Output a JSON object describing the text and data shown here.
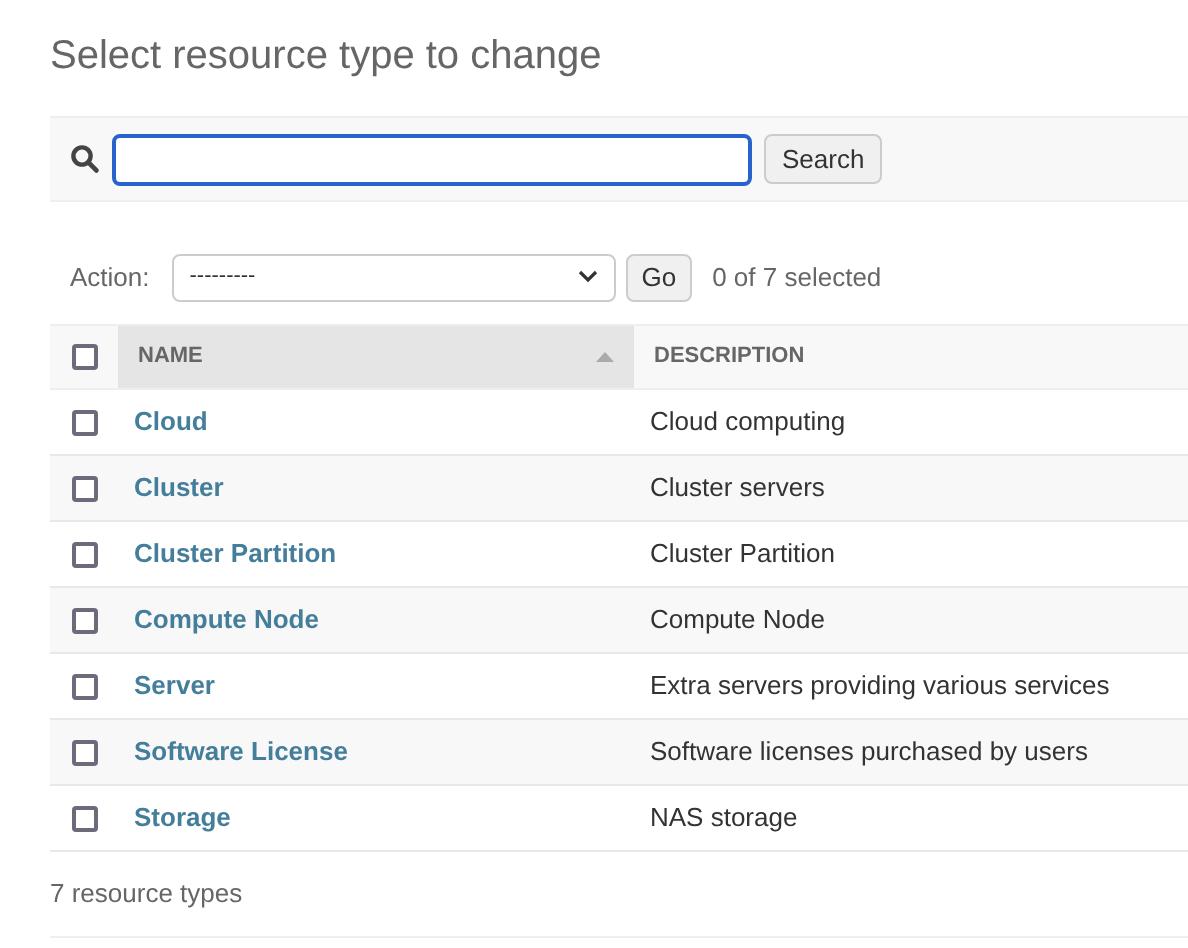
{
  "title": "Select resource type to change",
  "search": {
    "focused": true,
    "button": "Search"
  },
  "actions": {
    "label": "Action:",
    "value": "---------",
    "button": "Go",
    "counter": "0 of 7 selected"
  },
  "table": {
    "select_all": {
      "checked": false
    },
    "columns": [
      {
        "label": "NAME",
        "sorted": true
      },
      {
        "label": "DESCRIPTION",
        "sorted": false
      }
    ],
    "rows": [
      {
        "checked": false,
        "name": "Cloud",
        "description": "Cloud computing"
      },
      {
        "checked": false,
        "name": "Cluster",
        "description": "Cluster servers"
      },
      {
        "checked": false,
        "name": "Cluster Partition",
        "description": "Cluster Partition"
      },
      {
        "checked": false,
        "name": "Compute Node",
        "description": "Compute Node"
      },
      {
        "checked": false,
        "name": "Server",
        "description": "Extra servers providing various services"
      },
      {
        "checked": false,
        "name": "Software License",
        "description": "Software licenses purchased by users"
      },
      {
        "checked": false,
        "name": "Storage",
        "description": "NAS storage"
      }
    ]
  },
  "footer": "7 resource types"
}
